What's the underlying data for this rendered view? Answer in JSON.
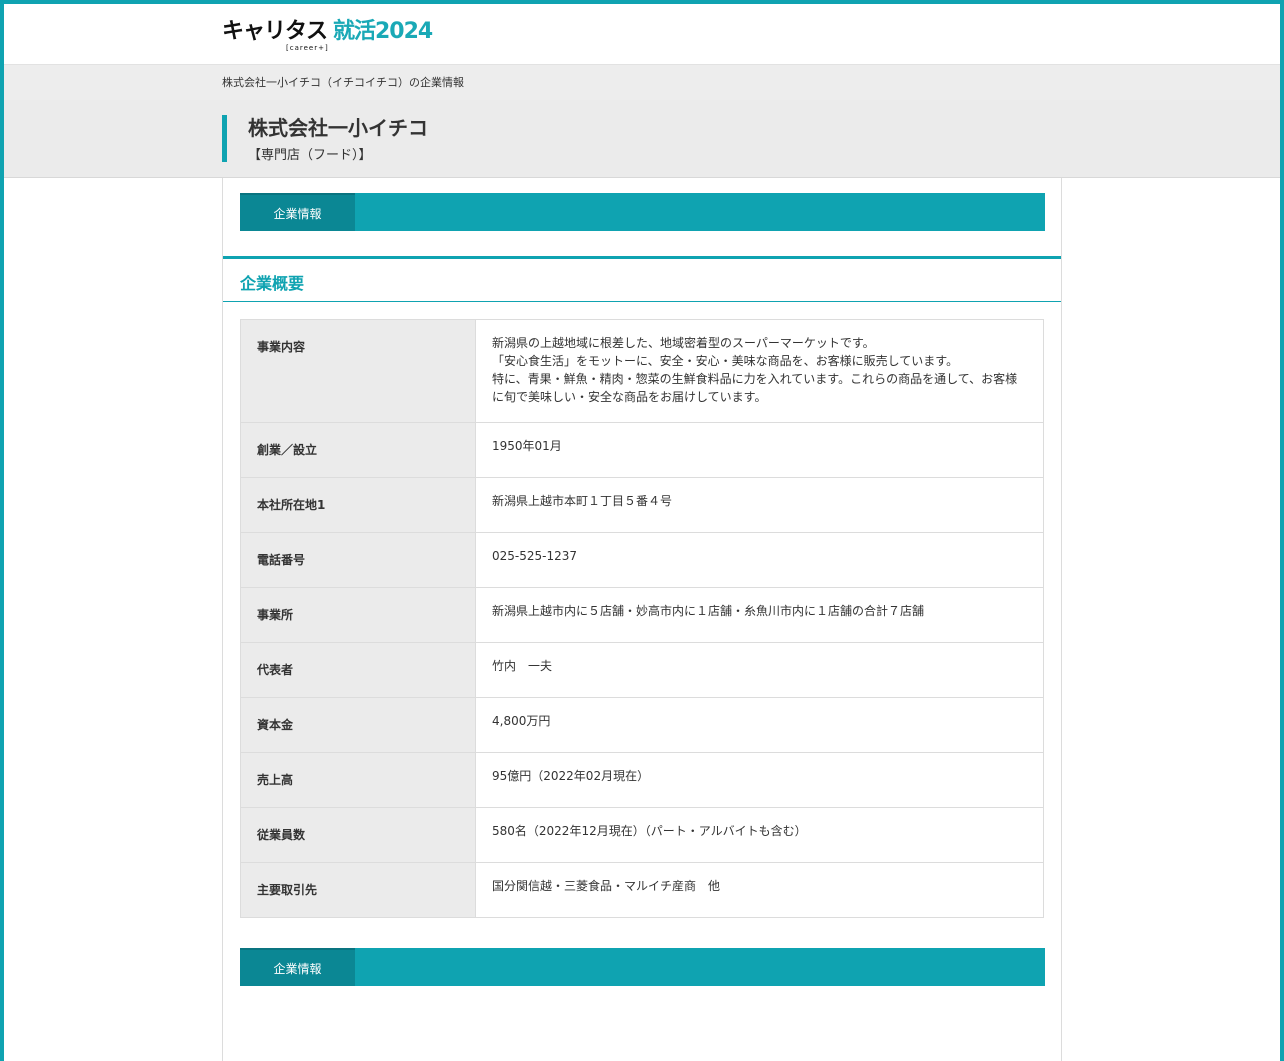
{
  "header": {
    "logo_main": "キャリタス",
    "logo_accent": "就活2024",
    "logo_sub": "[career+]"
  },
  "breadcrumb": "株式会社一小イチコ（イチコイチコ）の企業情報",
  "company": {
    "name": "株式会社一小イチコ",
    "category": "【専門店（フード）】"
  },
  "tabs": {
    "top_label": "企業情報",
    "bottom_label": "企業情報"
  },
  "section_title": "企業概要",
  "rows": [
    {
      "label": "事業内容",
      "lines": [
        "新潟県の上越地域に根差した、地域密着型のスーパーマーケットです。",
        "「安心食生活」をモットーに、安全・安心・美味な商品を、お客様に販売しています。",
        "特に、青果・鮮魚・精肉・惣菜の生鮮食料品に力を入れています。これらの商品を通して、お客様に旬で美味しい・安全な商品をお届けしています。"
      ]
    },
    {
      "label": "創業／設立",
      "lines": [
        "1950年01月"
      ]
    },
    {
      "label": "本社所在地1",
      "lines": [
        "新潟県上越市本町１丁目５番４号"
      ]
    },
    {
      "label": "電話番号",
      "lines": [
        "025-525-1237"
      ]
    },
    {
      "label": "事業所",
      "lines": [
        "新潟県上越市内に５店舗・妙高市内に１店舗・糸魚川市内に１店舗の合計７店舗"
      ]
    },
    {
      "label": "代表者",
      "lines": [
        "竹内　一夫"
      ]
    },
    {
      "label": "資本金",
      "lines": [
        "4,800万円"
      ]
    },
    {
      "label": "売上高",
      "lines": [
        "95億円（2022年02月現在）"
      ]
    },
    {
      "label": "従業員数",
      "lines": [
        "580名（2022年12月現在）（パート・アルバイトも含む）"
      ]
    },
    {
      "label": "主要取引先",
      "lines": [
        "国分関信越・三菱食品・マルイチ産商　他"
      ]
    }
  ]
}
